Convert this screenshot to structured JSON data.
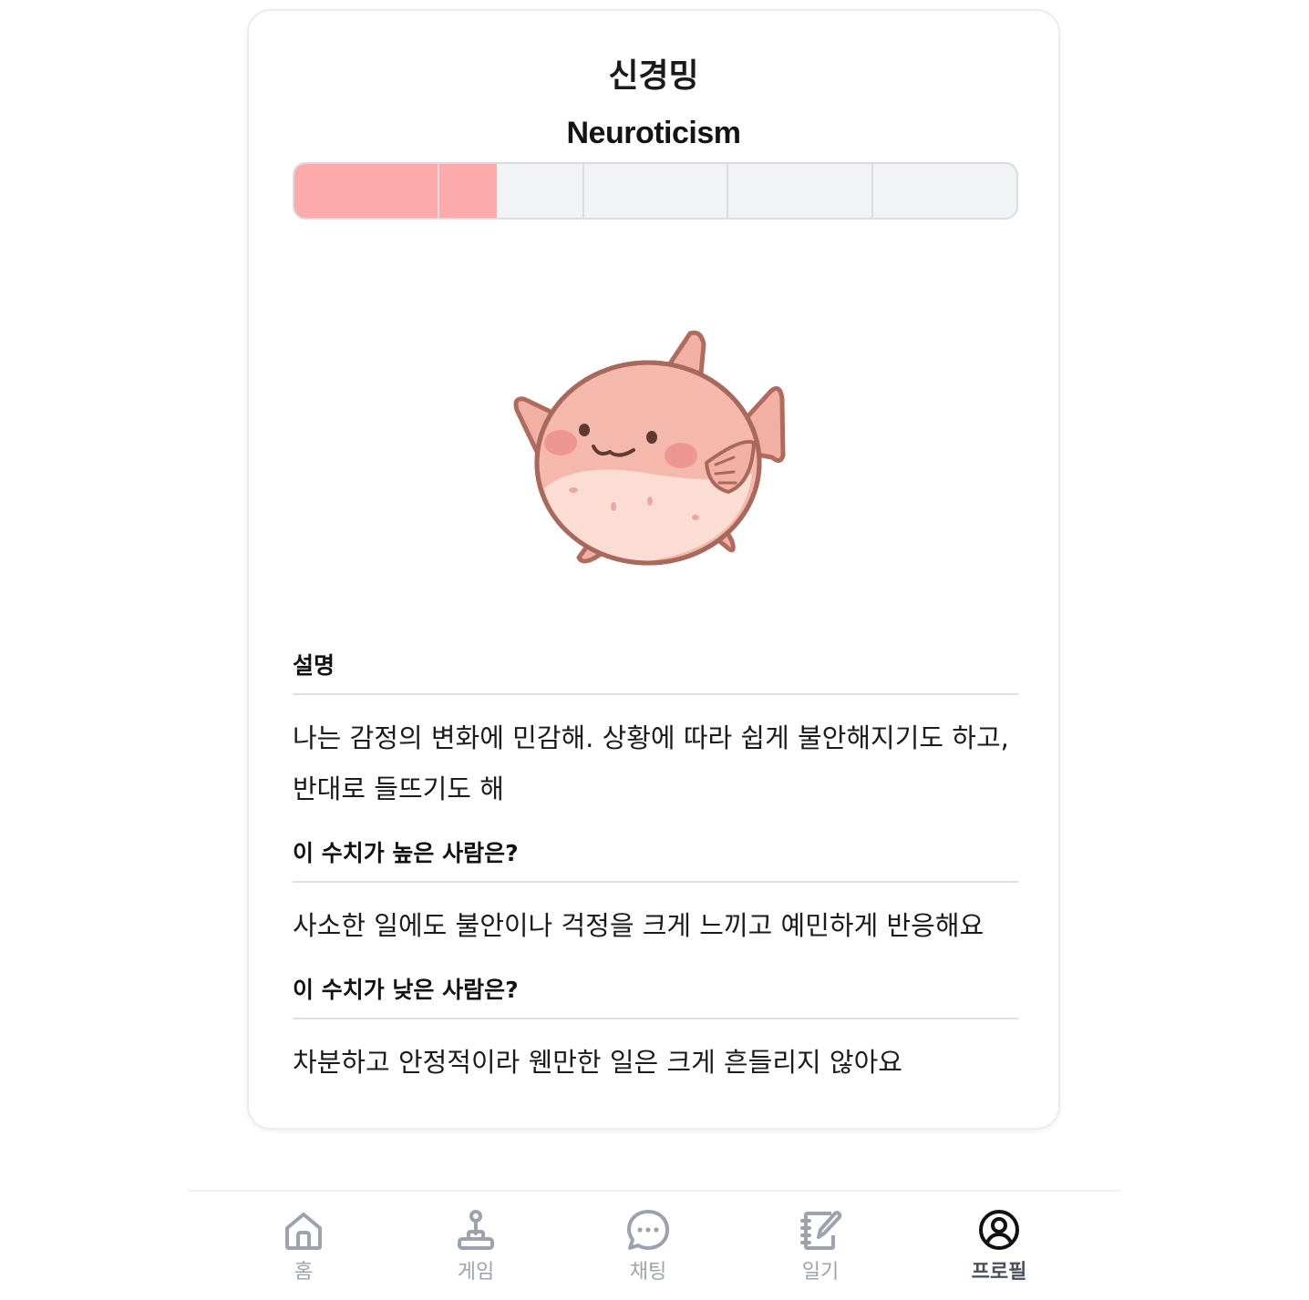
{
  "trait": {
    "title_ko": "신경밍",
    "title_en": "Neuroticism",
    "level": 0.28,
    "segments": 5,
    "fill_color": "#fdaaab",
    "mascot": "pufferfish-mascot"
  },
  "sections": [
    {
      "heading": "설명",
      "body": "나는 감정의 변화에 민감해. 상황에 따라 쉽게 불안해지기도 하고, 반대로 들뜨기도 해"
    },
    {
      "heading": "이 수치가 높은 사람은?",
      "body": "사소한 일에도 불안이나 걱정을 크게 느끼고 예민하게 반응해요"
    },
    {
      "heading": "이 수치가 낮은 사람은?",
      "body": "차분하고 안정적이라 웬만한 일은 크게 흔들리지 않아요"
    }
  ],
  "nav": {
    "items": [
      {
        "label": "홈",
        "icon": "home-icon"
      },
      {
        "label": "게임",
        "icon": "joystick-icon"
      },
      {
        "label": "채팅",
        "icon": "chat-bubble-icon"
      },
      {
        "label": "일기",
        "icon": "diary-icon"
      },
      {
        "label": "프로필",
        "icon": "profile-icon"
      }
    ],
    "active": "프로필"
  }
}
